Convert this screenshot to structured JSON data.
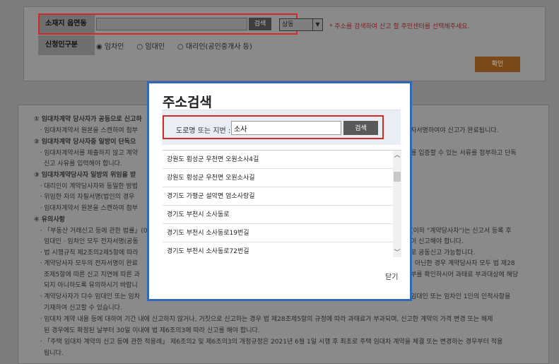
{
  "form": {
    "location_label": "소재지 읍면동",
    "search_button": "검색",
    "district_select": "상동",
    "hint": "* 주소를 검색하여 신고 할 주민센터를 선택해주세요.",
    "applicant_label": "신청인구분",
    "radio_tenant": "◉ 임차인",
    "radio_landlord": "○ 임대인",
    "radio_agent": "○ 대리인(공인중개사 등)",
    "confirm_button": "확인"
  },
  "notice": {
    "lines": [
      "① 임대차계약 당사자가 공동으로 신고하",
      "ㆍ임대차계약서 원본을 스캔하여 첨부",
      "② 임대차계약 당사자중 일방이 단독으",
      "ㆍ임대차계약서를 제출하지 않고 계약",
      "신고 사유를 입력해야 합니다.",
      "③ 임대차계약당사자 일방의 위임을 받",
      "ㆍ대리인이 계약당사자와 동일한 방법",
      "ㆍ위임한 자의 자필서명(법인의 경우",
      "ㆍ임대차계약서 원본을 스캔하여 첨부",
      "④ 유의사항",
      "ㆍ「부동산 거래신고 등에 관한 법률」(0",
      "임대인 · 임차인 모두 전자서명(공동",
      "ㆍ법 시행규칙 제2조의2제5항에 따라",
      "ㆍ계약당사자 모두의 전자서명이 완료",
      "조제5항에 따른 신고 지연에 따른 과",
      "되지 아니하도록 유의하시기 바랍니",
      "ㆍ계약당사자가 다수 임대인 또는 임차",
      "기재하여 신고할 수 있습니다.",
      "ㆍ임대차 계약 내용 등에 대하여 기간 내에 신고하지 않거나, 거짓으로 신고하는 경우 법 제28조제5항의 규정에 따라 과태료가 부과되며, 신고한 계약의 가격 변경 또는 해제",
      "된 경우에도 확정된 날부터 30일 이내에 법 제6조의3에 따라 신고를 해야 합니다.",
      "ㆍ「주택 임대차 계약의 신고 등에 관한 적용례」 제6조의2 및 제6조의3의 개정규정은 2021년 6월 1일 시행 후 최초로 주택 임대차 계약을 체결 또는 변경하는 경우부터 적용",
      "됩니다."
    ],
    "right_lines": [
      "자서명하여야 신고가 완료됩니다.",
      "를 입증할 수 있는 서류를 첨부하고 단독",
      "(이하 \"계약당사자\")는 신고서 등록 후",
      "이 신고해야 합니다.",
      "로 공동신고 가능합니다.",
      "| 아닌한 경우 계약당사자 모두 법 제28",
      "부를 확인하시어 과태료 부과대상에 해당",
      "임대인 또는 임차인 1인의 인적사항을"
    ]
  },
  "modal": {
    "title": "주소검색",
    "road_label": "도로명 또는 지번 :",
    "road_value": "소사",
    "search_button": "검색",
    "results": [
      "강원도 횡성군 우천면 오원소사4길",
      "강원도 횡성군 우천면 오원소사길",
      "경기도 가평군 설악면 엄소사랑길",
      "경기도 부천시 소사동로",
      "경기도 부천시 소사동로19번길",
      "경기도 부천시 소사동로72번길"
    ],
    "close": "닫기"
  }
}
